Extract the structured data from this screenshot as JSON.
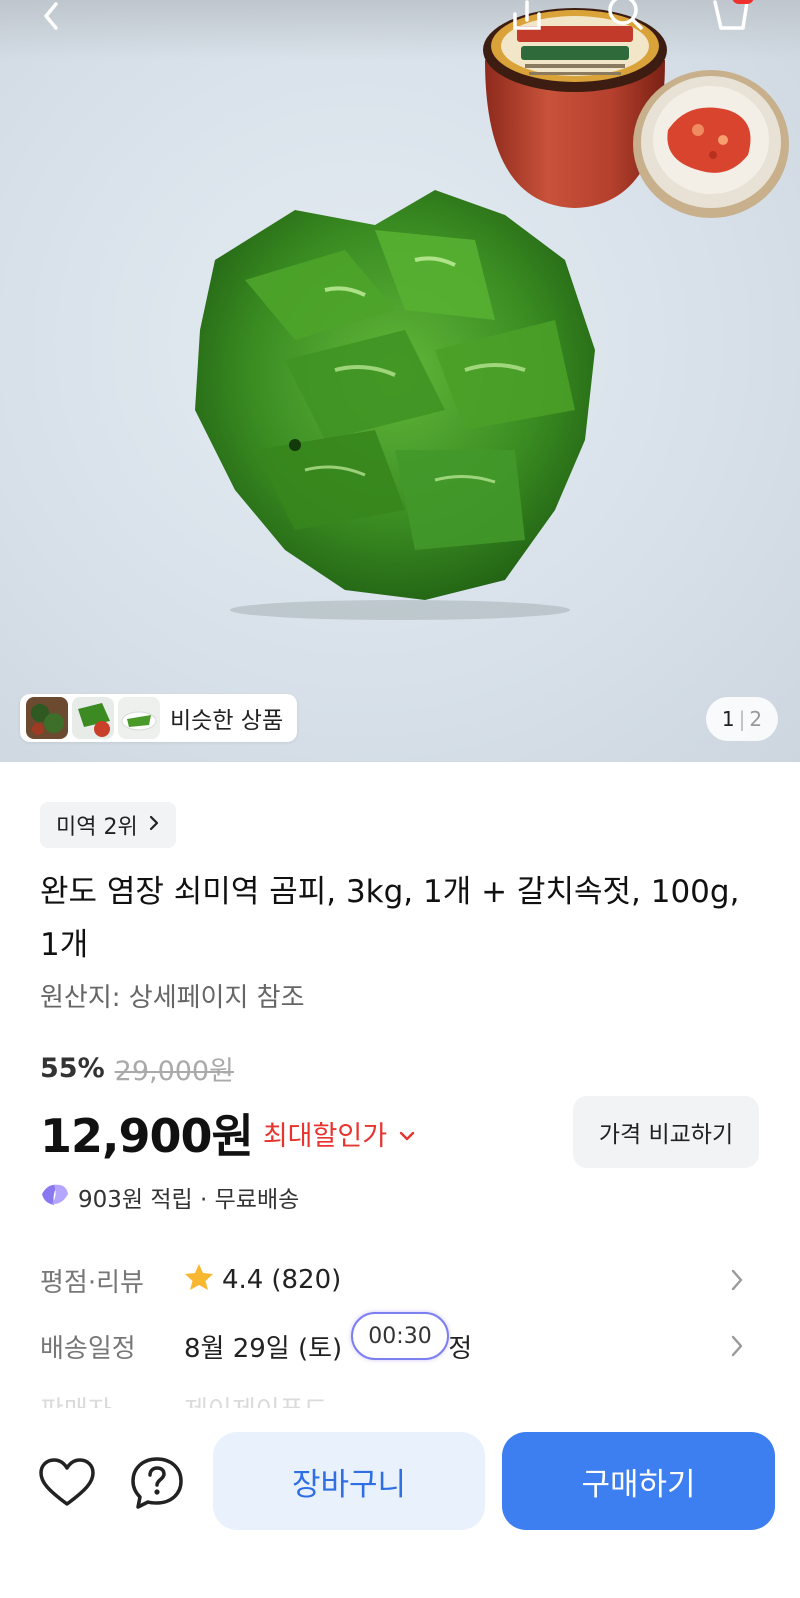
{
  "header": {
    "back_icon": "chevron-left-icon",
    "share_icon": "share-icon",
    "search_icon": "search-icon",
    "cart_icon": "cart-icon"
  },
  "gallery": {
    "similar_label": "비슷한 상품",
    "page_current": "1",
    "page_separator": "|",
    "page_total": "2"
  },
  "product": {
    "rank_label": "미역 2위",
    "title": "완도 염장 쇠미역 곰피, 3kg, 1개 + 갈치속젓, 100g, 1개",
    "origin": "원산지: 상세페이지 참조",
    "discount_percent": "55%",
    "original_price": "29,000원",
    "price": "12,900원",
    "max_discount_label": "최대할인가",
    "compare_button": "가격 비교하기",
    "reward_text": "903원 적립 · 무료배송"
  },
  "info_rows": {
    "rating": {
      "label": "평점·리뷰",
      "score": "4.4",
      "count": "(820)"
    },
    "delivery": {
      "label": "배송일정",
      "date": "8월 29일 (토)",
      "suffix": "정",
      "timer": "00:30"
    },
    "seller": {
      "label": "판매자",
      "value": "제이제이푸드"
    }
  },
  "bottom_bar": {
    "wishlist_icon": "heart-icon",
    "inquiry_icon": "question-icon",
    "cart_button": "장바구니",
    "buy_button": "구매하기"
  },
  "colors": {
    "accent_blue": "#3d7ef0",
    "cart_button_bg": "#e9f1fd",
    "discount_red": "#e8342f",
    "star": "#f7b731"
  }
}
